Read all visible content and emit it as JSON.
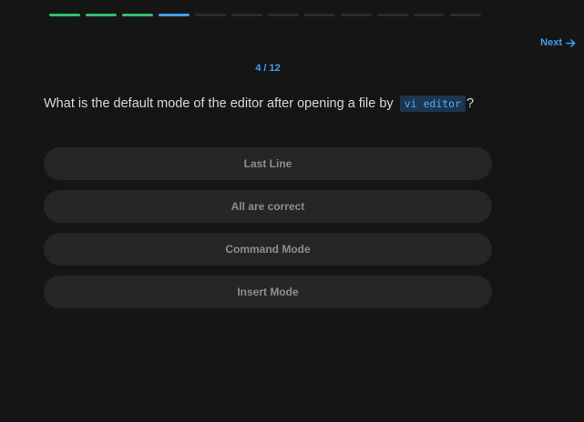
{
  "progress": {
    "total": 12,
    "current": 4,
    "segments": [
      "completed",
      "completed",
      "completed",
      "current",
      "pending",
      "pending",
      "pending",
      "pending",
      "pending",
      "pending",
      "pending",
      "pending"
    ],
    "colors": {
      "completed": "#2fbf71",
      "current": "#3fa0ee",
      "pending": "#2c2c2c"
    }
  },
  "nav": {
    "next_label": "Next",
    "next_icon": "arrow-right-icon"
  },
  "counter": "4 / 12",
  "question": {
    "text": "What is the default mode of the editor after opening a file by",
    "code": "vi editor",
    "suffix": "?"
  },
  "options": [
    {
      "label": "Last Line"
    },
    {
      "label": "All are correct"
    },
    {
      "label": "Command Mode"
    },
    {
      "label": "Insert Mode"
    }
  ]
}
